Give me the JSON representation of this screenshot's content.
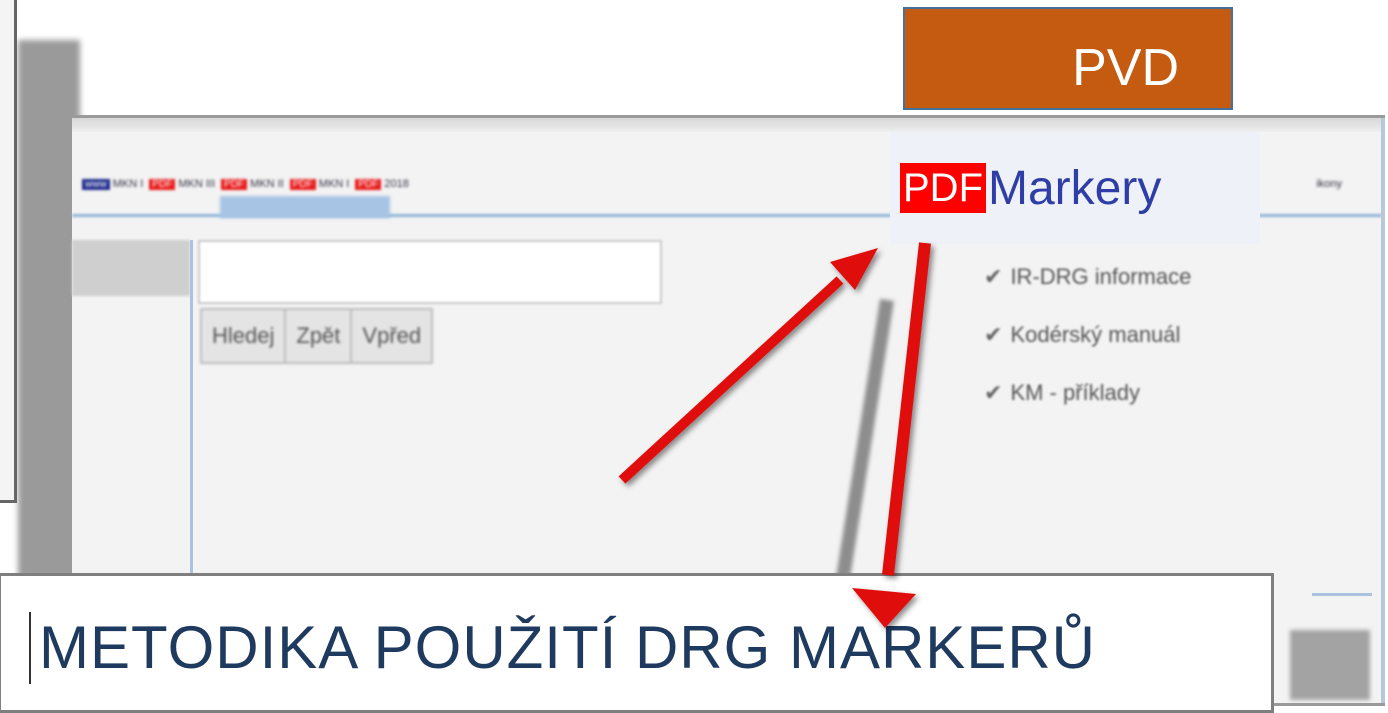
{
  "badge": {
    "label": "PVD",
    "color": "#c55a11"
  },
  "nav": {
    "items": [
      {
        "badge": "www",
        "text": "MKN I"
      },
      {
        "badge": "PDF",
        "text": "MKN III"
      },
      {
        "badge": "PDF",
        "text": "MKN II"
      },
      {
        "badge": "PDF",
        "text": "MKN I"
      },
      {
        "badge": "PDF",
        "text": "2018"
      }
    ],
    "tail": "ikony"
  },
  "markery": {
    "badge": "PDF",
    "label": "Markery"
  },
  "buttons": {
    "search": "Hledej",
    "back": "Zpět",
    "forward": "Vpřed"
  },
  "checkboxes": [
    {
      "label": "IR-DRG informace",
      "checked": true
    },
    {
      "label": "Kodérský manuál",
      "checked": true
    },
    {
      "label": "KM - příklady",
      "checked": true
    }
  ],
  "title": "METODIKA POUŽITÍ DRG MARKERŮ",
  "colors": {
    "arrow": "#e01010",
    "link": "#2f3ea6",
    "pdf": "#ff0000"
  }
}
